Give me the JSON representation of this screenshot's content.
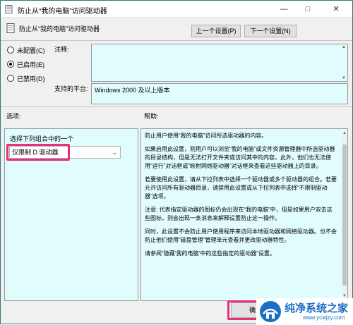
{
  "window": {
    "title": "防止从“我的电脑”访问驱动器"
  },
  "header": {
    "setting_title": "防止从“我的电脑”访问驱动器",
    "prev_label": "上一个设置(P)",
    "next_label": "下一个设置(N)"
  },
  "state": {
    "options": [
      {
        "label": "未配置(C)",
        "checked": false
      },
      {
        "label": "已启用(E)",
        "checked": true
      },
      {
        "label": "已禁用(D)",
        "checked": false
      }
    ]
  },
  "comment": {
    "label": "注释:"
  },
  "platform": {
    "label": "支持的平台:",
    "value": "Windows 2000 及以上版本"
  },
  "options_section": {
    "label": "选项:",
    "caption": "选择下列组合中的一个",
    "selected": "仅限制 D 驱动器"
  },
  "help_section": {
    "label": "帮助:",
    "paragraphs": [
      "防止用户使用“我的电脑”访问所选驱动器的内容。",
      "如果启用此设置，则用户可以浏览“我的电脑”或文件资源管理器中所选驱动器的目录结构，但是无法打开文件夹或访问其中的内容。此外，他们也无法使用“运行”对话框或“映射网络驱动器”对话框来查看这些驱动器上的目录。",
      "若要使用此设置，请从下拉列表中选择一个驱动器或多个驱动器的组合。若要允许访问所有驱动器目录，请禁用此设置或从下拉列表中选择“不限制驱动器”选项。",
      "注意: 代表指定驱动器的图标仍会出现在“我的电脑”中，但是如果用户双击这些图标，则会出现一条消息来解释设置防止这一操作。",
      " 同时，此设置不会防止用户使用程序来访问本地驱动器和网络驱动器。也不会防止他们使用“磁盘管理”管理单元查看并更改驱动器特性。",
      "请参阅“隐藏‘我的电脑’中的这些指定的驱动器”设置。"
    ]
  },
  "footer": {
    "ok_label": "确定"
  },
  "watermark": {
    "name": "纯净系统之家",
    "url": "www.ycwjzy.com"
  },
  "colors": {
    "pane_bg": "#e0fcfc",
    "highlight": "#e8307a",
    "window_border": "#2c7c7c"
  },
  "icons": {
    "title": "policy-icon",
    "min": "minimize-icon",
    "max": "maximize-icon",
    "close": "close-icon"
  }
}
